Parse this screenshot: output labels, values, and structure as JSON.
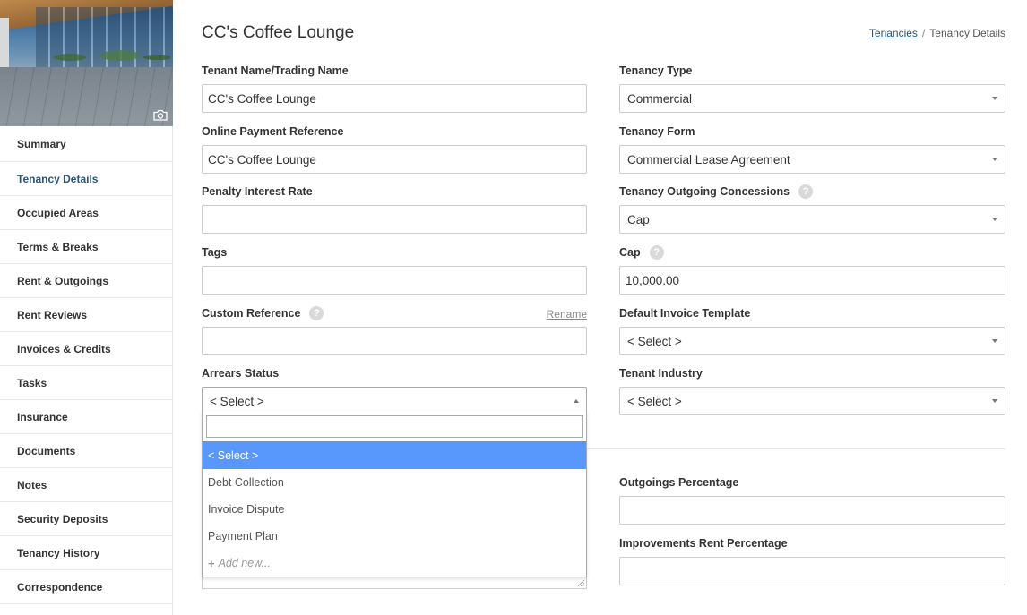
{
  "sidebar": {
    "items": [
      {
        "label": "Summary"
      },
      {
        "label": "Tenancy Details"
      },
      {
        "label": "Occupied Areas"
      },
      {
        "label": "Terms & Breaks"
      },
      {
        "label": "Rent & Outgoings"
      },
      {
        "label": "Rent Reviews"
      },
      {
        "label": "Invoices & Credits"
      },
      {
        "label": "Tasks"
      },
      {
        "label": "Insurance"
      },
      {
        "label": "Documents"
      },
      {
        "label": "Notes"
      },
      {
        "label": "Security Deposits"
      },
      {
        "label": "Tenancy History"
      },
      {
        "label": "Correspondence"
      }
    ],
    "active": "Tenancy Details",
    "hero_icon": "camera-icon"
  },
  "header": {
    "title": "CC's Coffee Lounge",
    "breadcrumb": {
      "link": "Tenancies",
      "separator": "/",
      "current": "Tenancy Details"
    }
  },
  "form": {
    "tenant_name": {
      "label": "Tenant Name/Trading Name",
      "value": "CC's Coffee Lounge"
    },
    "online_payment_reference": {
      "label": "Online Payment Reference",
      "value": "CC's Coffee Lounge"
    },
    "penalty_interest_rate": {
      "label": "Penalty Interest Rate",
      "value": ""
    },
    "tags": {
      "label": "Tags",
      "value": ""
    },
    "custom_reference": {
      "label": "Custom Reference",
      "value": "",
      "rename_label": "Rename",
      "help": "?"
    },
    "arrears_status": {
      "label": "Arrears Status",
      "value": "< Select >"
    },
    "tenancy_type": {
      "label": "Tenancy Type",
      "value": "Commercial"
    },
    "tenancy_form": {
      "label": "Tenancy Form",
      "value": "Commercial Lease Agreement"
    },
    "outgoing_concessions": {
      "label": "Tenancy Outgoing Concessions",
      "value": "Cap",
      "help": "?"
    },
    "cap": {
      "label": "Cap",
      "value": "10,000.00",
      "help": "?"
    },
    "default_invoice_template": {
      "label": "Default Invoice Template",
      "value": "< Select >"
    },
    "tenant_industry": {
      "label": "Tenant Industry",
      "value": "< Select >"
    },
    "outgoings_percentage": {
      "label": "Outgoings Percentage",
      "value": ""
    },
    "improvements_rent_percentage": {
      "label": "Improvements Rent Percentage",
      "value": ""
    }
  },
  "arrears_dropdown": {
    "search_value": "",
    "options": [
      "< Select >",
      "Debt Collection",
      "Invoice Dispute",
      "Payment Plan"
    ],
    "highlighted": "< Select >",
    "add_new": "Add new...",
    "highlight_color": "#5897fb"
  }
}
